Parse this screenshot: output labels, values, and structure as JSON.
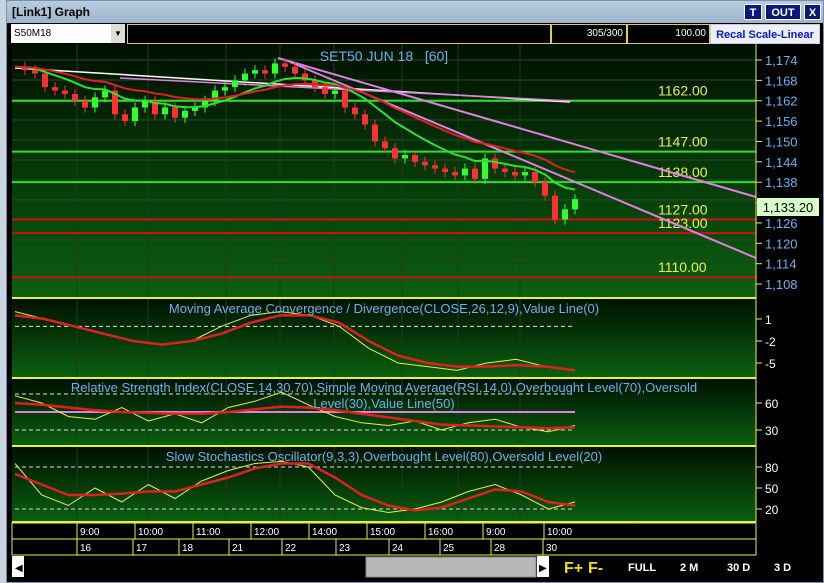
{
  "window": {
    "title": "[Link1] Graph",
    "btn_t": "T",
    "btn_out": "OUT",
    "btn_x": "X"
  },
  "toolbar": {
    "symbol": "S50M18",
    "bars": "305/300",
    "zoom": "100.00",
    "recal": "Recal Scale-Linear"
  },
  "main": {
    "title": "SET50 JUN 18   [60]",
    "last_price": "1,133.20",
    "y_ticks": [
      "1,174",
      "1,168",
      "1,162",
      "1,156",
      "1,150",
      "1,144",
      "1,138",
      "1,132",
      "1,126",
      "1,120",
      "1,114",
      "1,108"
    ],
    "levels": [
      {
        "label": "1162.00",
        "value": 1162,
        "color": "#30e030"
      },
      {
        "label": "1147.00",
        "value": 1147,
        "color": "#30e030"
      },
      {
        "label": "1138.00",
        "value": 1138,
        "color": "#30e030"
      },
      {
        "label": "1127.00",
        "value": 1127,
        "color": "#d01010"
      },
      {
        "label": "1123.00",
        "value": 1123,
        "color": "#d01010"
      },
      {
        "label": "1110.00",
        "value": 1110,
        "color": "#d01010"
      }
    ]
  },
  "macd": {
    "title": "Moving Average Convergence / Divergence(CLOSE,26,12,9),Value Line(0)",
    "y_ticks": [
      "1",
      "-2",
      "-5"
    ]
  },
  "rsi": {
    "title": "Relative Strength Index(CLOSE,14,30,70),Simple Moving Average(RSI,14,0),Overbought Level(70),Oversold",
    "title2": "Level(30),Value Line(50)",
    "y_ticks": [
      "60",
      "30"
    ]
  },
  "stoch": {
    "title": "Slow Stochastics Oscillator(9,3,3),Overbought Level(80),Oversold Level(20)",
    "y_ticks": [
      "80",
      "50",
      "20"
    ]
  },
  "time_axis": [
    "9:00",
    "10:00",
    "11:00",
    "12:00",
    "14:00",
    "15:00",
    "16:00",
    "9:00",
    "10:00"
  ],
  "day_axis": [
    "16",
    "17",
    "18",
    "21",
    "22",
    "23",
    "24",
    "25",
    "28",
    "30"
  ],
  "bottom": {
    "fplus": "F+",
    "fminus": "F-",
    "full": "FULL",
    "m2": "2 M",
    "d30": "30 D",
    "d3": "3 D"
  },
  "chart_data": {
    "type": "line",
    "title": "SET50 JUN 18 [60]",
    "ylim": [
      1105,
      1177
    ],
    "closes": [
      1172,
      1171,
      1170,
      1166,
      1165,
      1164,
      1162,
      1160,
      1163,
      1165,
      1158,
      1156,
      1160,
      1162,
      1158,
      1160,
      1157,
      1159,
      1160,
      1162,
      1165,
      1166,
      1168,
      1170,
      1171,
      1170,
      1173,
      1172,
      1170,
      1168,
      1166,
      1164,
      1165,
      1160,
      1158,
      1155,
      1150,
      1148,
      1145,
      1146,
      1144,
      1143,
      1142,
      1141,
      1140,
      1142,
      1139,
      1145,
      1142,
      1141,
      1140,
      1141,
      1138,
      1134,
      1127,
      1130,
      1133
    ],
    "macd_line": [
      2,
      1,
      0,
      -1,
      -2,
      -2.5,
      -2,
      0,
      1.5,
      2,
      1.5,
      0,
      -3,
      -5,
      -5.5,
      -6,
      -5,
      -4.5,
      -5.5,
      -6
    ],
    "macd_signal": [
      1.5,
      1,
      0,
      -1,
      -2,
      -2.5,
      -2,
      -1,
      0.5,
      1.5,
      1.5,
      0.5,
      -2,
      -4,
      -5,
      -5.5,
      -5.5,
      -5.3,
      -5.5,
      -6
    ],
    "rsi_line": [
      68,
      60,
      45,
      42,
      55,
      40,
      48,
      38,
      55,
      62,
      72,
      58,
      45,
      38,
      35,
      40,
      30,
      38,
      42,
      33,
      28,
      35
    ],
    "rsi_sma": [
      60,
      58,
      55,
      52,
      50,
      49,
      48,
      48,
      50,
      53,
      56,
      55,
      52,
      48,
      44,
      40,
      36,
      35,
      34,
      33,
      32,
      33
    ],
    "stoch_k": [
      85,
      40,
      25,
      50,
      30,
      55,
      35,
      60,
      75,
      85,
      88,
      80,
      40,
      22,
      15,
      20,
      30,
      45,
      55,
      40,
      20,
      30
    ],
    "stoch_d": [
      70,
      55,
      40,
      40,
      42,
      45,
      45,
      55,
      65,
      78,
      85,
      85,
      65,
      40,
      25,
      18,
      22,
      35,
      48,
      45,
      30,
      25
    ]
  }
}
